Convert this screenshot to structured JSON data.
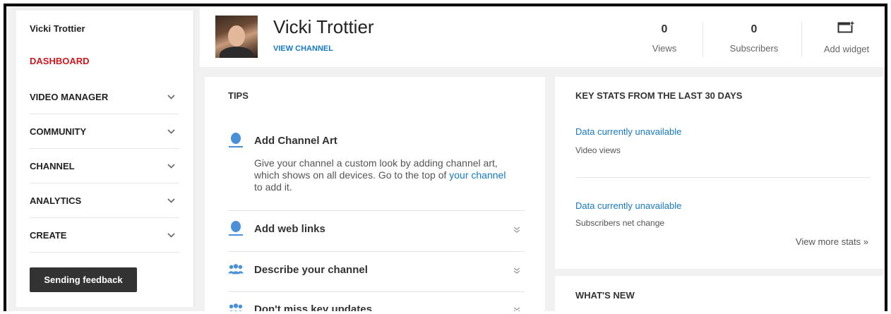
{
  "sidebar": {
    "user_name": "Vicki Trottier",
    "dashboard_label": "DASHBOARD",
    "items": [
      {
        "label": "VIDEO MANAGER"
      },
      {
        "label": "COMMUNITY"
      },
      {
        "label": "CHANNEL"
      },
      {
        "label": "ANALYTICS"
      },
      {
        "label": "CREATE"
      }
    ],
    "feedback_button": "Sending feedback"
  },
  "header": {
    "channel_name": "Vicki Trottier",
    "view_channel": "VIEW CHANNEL",
    "views": {
      "value": "0",
      "label": "Views"
    },
    "subscribers": {
      "value": "0",
      "label": "Subscribers"
    },
    "add_widget": "Add widget"
  },
  "tips": {
    "title": "TIPS",
    "items": [
      {
        "title": "Add Channel Art",
        "body_pre": "Give your channel a custom look by adding channel art, which shows on all devices. Go to the top of ",
        "body_link": "your channel",
        "body_post": " to add it.",
        "icon": "person-icon"
      },
      {
        "title": "Add web links",
        "icon": "person-icon"
      },
      {
        "title": "Describe your channel",
        "icon": "group-icon"
      },
      {
        "title": "Don't miss key updates",
        "icon": "group-icon"
      }
    ]
  },
  "key_stats": {
    "title": "KEY STATS FROM THE LAST 30 DAYS",
    "stats": [
      {
        "value": "Data currently unavailable",
        "label": "Video views"
      },
      {
        "value": "Data currently unavailable",
        "label": "Subscribers net change"
      }
    ],
    "view_more": "View more stats »"
  },
  "whats_new": {
    "title": "WHAT'S NEW"
  },
  "colors": {
    "accent_red": "#cc181e",
    "link_blue": "#167ac6",
    "button_dark": "#333333",
    "page_bg": "#f1f1f1"
  }
}
